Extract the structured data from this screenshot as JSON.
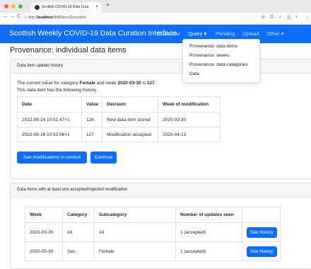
{
  "browser": {
    "tab_title": "Scottish COVID-19 Data Cura",
    "tab_close": "×",
    "new_tab": "+",
    "url_host": "localhost",
    "url_rest": ":8080/provQueryItem",
    "url_prefix": "http://",
    "back": "←",
    "forward": "→",
    "reload": "C",
    "info": "ⓘ",
    "zoom_icon": "⊖",
    "share_icon": "⎙",
    "star_icon": "☆",
    "side_icon": "◫",
    "ext_icon": "◐",
    "menu_icon": "⋮",
    "dot_colors": [
      "#ff5f57",
      "#febc2e",
      "#28c840"
    ]
  },
  "navbar": {
    "brand": "Scottish Weekly COVID-19 Data Curation Interface",
    "overview": "Overview",
    "query": "Query ▾",
    "pending": "Pending",
    "upload": "Upload",
    "other": "Other ▾",
    "color": "#0d6efd"
  },
  "dropdown": {
    "items": [
      "Provenance: data items",
      "Provenance: weeks",
      "Provenance: data categories",
      "Data"
    ]
  },
  "page": {
    "title": "Provenance: individual data items"
  },
  "card1": {
    "header": "Data item update history",
    "line1_pre": "The current value for category ",
    "category": "Female",
    "line1_mid": " and week ",
    "week": "2020-03-30",
    "line1_is": " is ",
    "value": "127",
    "line1_end": ".",
    "line2": "This data item has the following history.",
    "columns": [
      "Date",
      "Value",
      "Decision",
      "Week of modification"
    ],
    "rows": [
      [
        "2022-08-16 10:51:47+1",
        "126",
        "New data item stored",
        "2020-03-30"
      ],
      [
        "2022-08-16 10:52:06+1",
        "127",
        "Modification accepted",
        "2020-04-13"
      ]
    ],
    "btn_context": "See modifications in context",
    "btn_continue": "Continue"
  },
  "card2": {
    "header": "Data items with at least one accepted/rejected modification",
    "columns": [
      "Week",
      "Category",
      "Subcategory",
      "Number of updates seen",
      ""
    ],
    "rows": [
      [
        "2020-03-30",
        "All",
        "All",
        "1 (accepted)",
        "See history"
      ],
      [
        "2020-03-30",
        "Sex",
        "Female",
        "1 (accepted)",
        "See history"
      ]
    ]
  }
}
